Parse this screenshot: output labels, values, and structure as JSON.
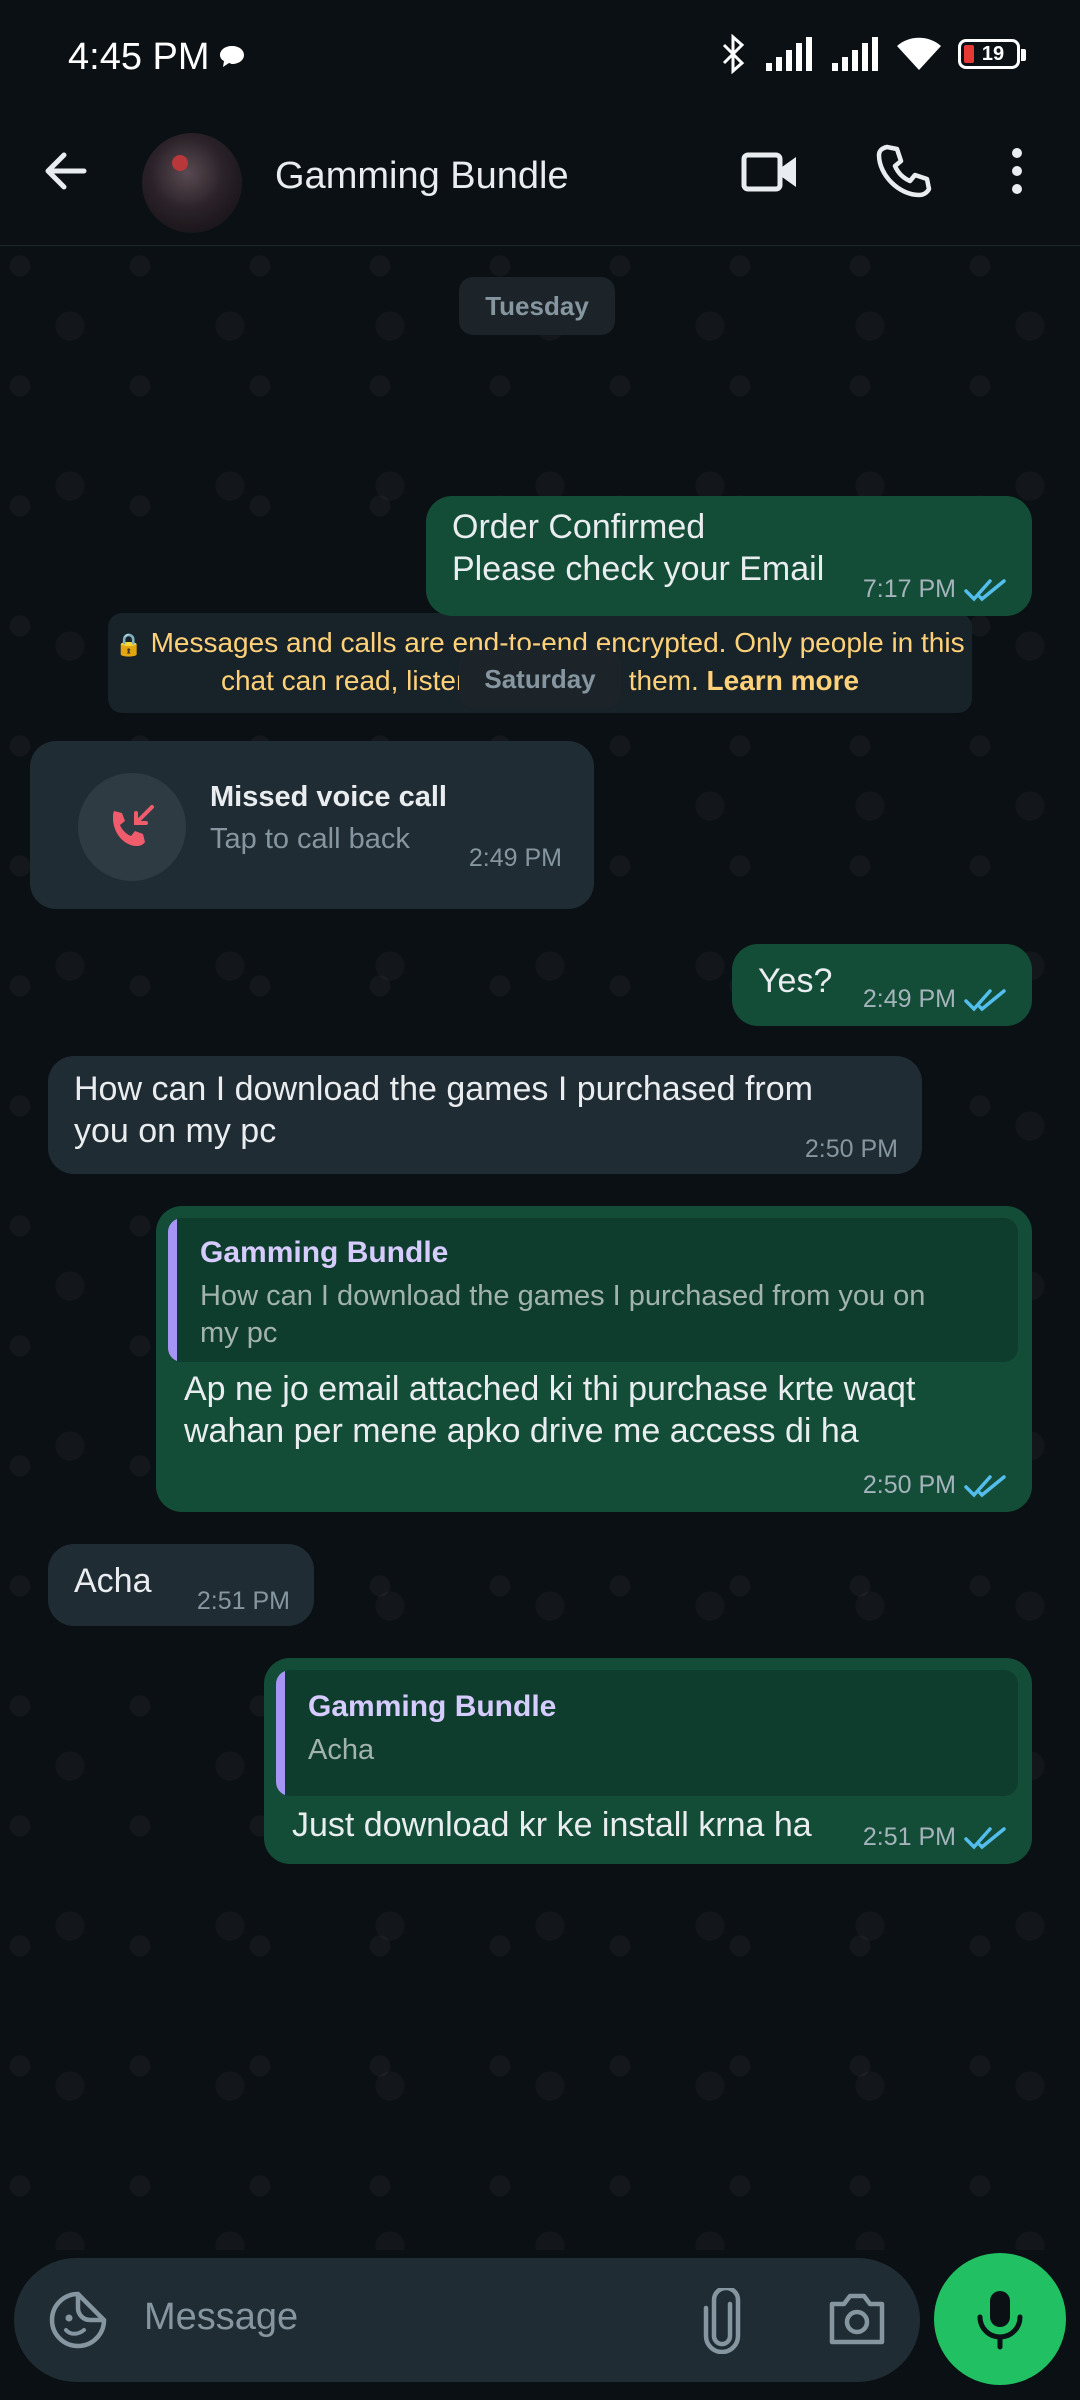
{
  "status_bar": {
    "time": "4:45 PM",
    "battery": "19"
  },
  "header": {
    "contact_name": "Gamming Bundle"
  },
  "chat": {
    "date_tuesday": "Tuesday",
    "encryption_notice": "Messages and calls are end-to-end encrypted. Only people in this chat can read, listen to, or share them.",
    "encryption_link": "Learn more",
    "date_saturday": "Saturday",
    "messages": [
      {
        "line1": "Order Confirmed",
        "line2": "Please check your Email",
        "time": "7:17 PM"
      },
      {
        "title": "Missed voice call",
        "subtitle": "Tap to call back",
        "time": "2:49 PM"
      },
      {
        "text": "Yes?",
        "time": "2:49 PM"
      },
      {
        "line1": "How can I download the games I purchased from",
        "line2": "you on my pc",
        "time": "2:50 PM"
      },
      {
        "quote_name": "Gamming Bundle",
        "quote_line1": "How can I download the games I purchased from you on",
        "quote_line2": "my pc",
        "line1": "Ap ne jo email attached ki thi purchase krte waqt",
        "line2": "wahan per mene apko drive me access di ha",
        "time": "2:50 PM"
      },
      {
        "text": "Acha",
        "time": "2:51 PM"
      },
      {
        "quote_name": "Gamming Bundle",
        "quote_text": "Acha",
        "text": "Just download kr ke install krna ha",
        "time": "2:51 PM"
      }
    ]
  },
  "input": {
    "placeholder": "Message"
  },
  "colors": {
    "outgoing_bubble": "#134d37",
    "incoming_bubble": "#202c33",
    "accent": "#21c063",
    "read_ticks": "#53bdeb"
  }
}
